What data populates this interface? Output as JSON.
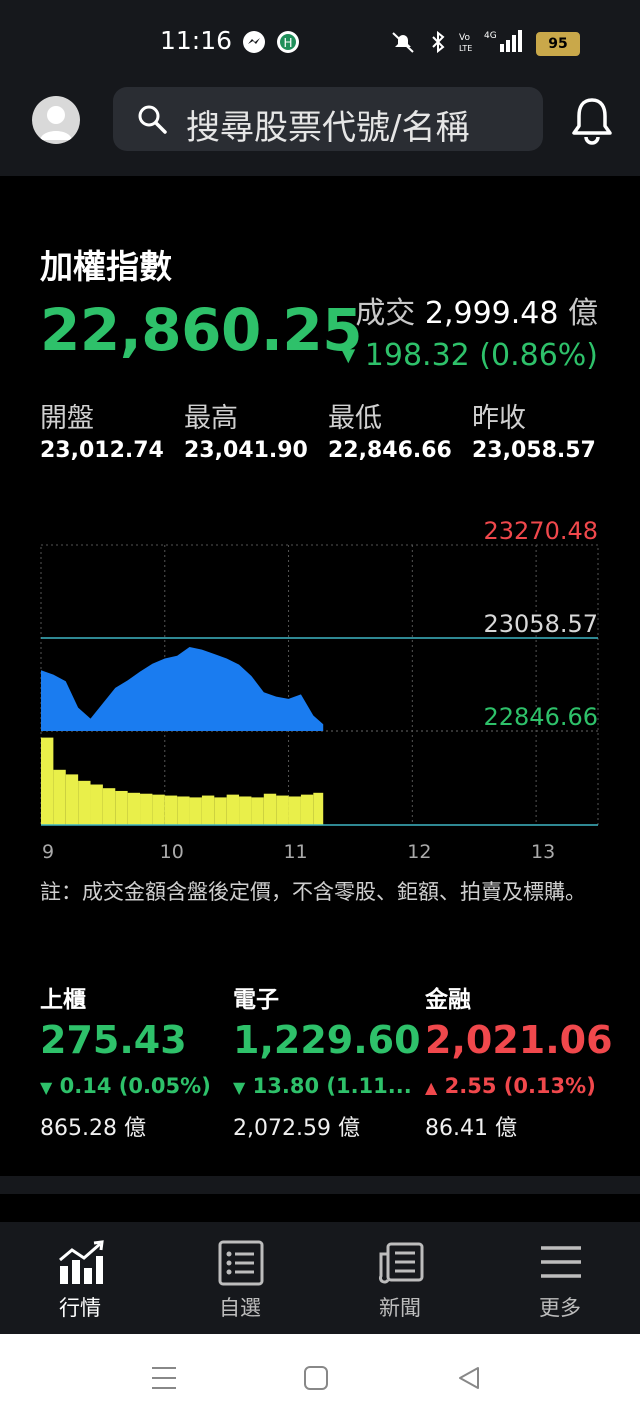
{
  "status": {
    "time": "11:16",
    "battery": "95"
  },
  "search": {
    "placeholder": "搜尋股票代號/名稱"
  },
  "index": {
    "name": "加權指數",
    "value": "22,860.25",
    "turnover_label": "成交",
    "turnover_value": "2,999.48",
    "turnover_unit": "億",
    "change_arrow": "▼",
    "change": "198.32 (0.86%)",
    "ohlc": [
      {
        "label": "開盤",
        "value": "23,012.74"
      },
      {
        "label": "最高",
        "value": "23,041.90"
      },
      {
        "label": "最低",
        "value": "22,846.66"
      },
      {
        "label": "昨收",
        "value": "23,058.57"
      }
    ]
  },
  "chart_data": {
    "type": "area",
    "title": "",
    "y_labels": [
      "23270.48",
      "23058.57",
      "22846.66"
    ],
    "ylim": [
      22846.66,
      23270.48
    ],
    "reference_line": 23058.57,
    "x_ticks": [
      "9",
      "10",
      "11",
      "12",
      "13"
    ],
    "x_range": [
      9.0,
      13.5
    ],
    "grid": true,
    "series": [
      {
        "kind": "price",
        "color": "#1a7cf0",
        "x": [
          9.0,
          9.1,
          9.2,
          9.3,
          9.4,
          9.5,
          9.6,
          9.7,
          9.8,
          9.9,
          10.0,
          10.1,
          10.2,
          10.3,
          10.4,
          10.5,
          10.6,
          10.7,
          10.8,
          10.9,
          11.0,
          11.1,
          11.2,
          11.28
        ],
        "values": [
          22985,
          22975,
          22960,
          22900,
          22875,
          22910,
          22945,
          22962,
          22982,
          23000,
          23012,
          23018,
          23038,
          23032,
          23022,
          23012,
          22998,
          22972,
          22935,
          22925,
          22920,
          22930,
          22882,
          22862
        ]
      },
      {
        "kind": "volume",
        "color": "#e9ef4a",
        "x": [
          9.0,
          9.1,
          9.2,
          9.3,
          9.4,
          9.5,
          9.6,
          9.7,
          9.8,
          9.9,
          10.0,
          10.1,
          10.2,
          10.3,
          10.4,
          10.5,
          10.6,
          10.7,
          10.8,
          10.9,
          11.0,
          11.1,
          11.2,
          11.28
        ],
        "values": [
          95,
          60,
          55,
          48,
          44,
          40,
          37,
          35,
          34,
          33,
          32,
          31,
          30,
          32,
          30,
          33,
          31,
          30,
          34,
          32,
          31,
          33,
          35,
          30
        ],
        "ylim": [
          0,
          100
        ]
      }
    ]
  },
  "note": "註：成交金額含盤後定價，不含零股、鉅額、拍賣及標購。",
  "sectors": [
    {
      "name": "上櫃",
      "value": "275.43",
      "arrow": "▼",
      "change": "0.14 (0.05%)",
      "amount": "865.28 億",
      "dir": "down"
    },
    {
      "name": "電子",
      "value": "1,229.60",
      "arrow": "▼",
      "change": "13.80 (1.11...",
      "amount": "2,072.59 億",
      "dir": "down"
    },
    {
      "name": "金融",
      "value": "2,021.06",
      "arrow": "▲",
      "change": "2.55 (0.13%)",
      "amount": "86.41 億",
      "dir": "up"
    }
  ],
  "tabs": [
    {
      "label": "行情",
      "icon": "chart-icon",
      "active": true
    },
    {
      "label": "自選",
      "icon": "list-icon",
      "active": false
    },
    {
      "label": "新聞",
      "icon": "news-icon",
      "active": false
    },
    {
      "label": "更多",
      "icon": "menu-icon",
      "active": false
    }
  ],
  "colors": {
    "green": "#2ec16a",
    "red": "#f0484c",
    "price_fill": "#1a7cf0",
    "volume_fill": "#e9ef4a",
    "ref_line": "#3fb6c4"
  }
}
